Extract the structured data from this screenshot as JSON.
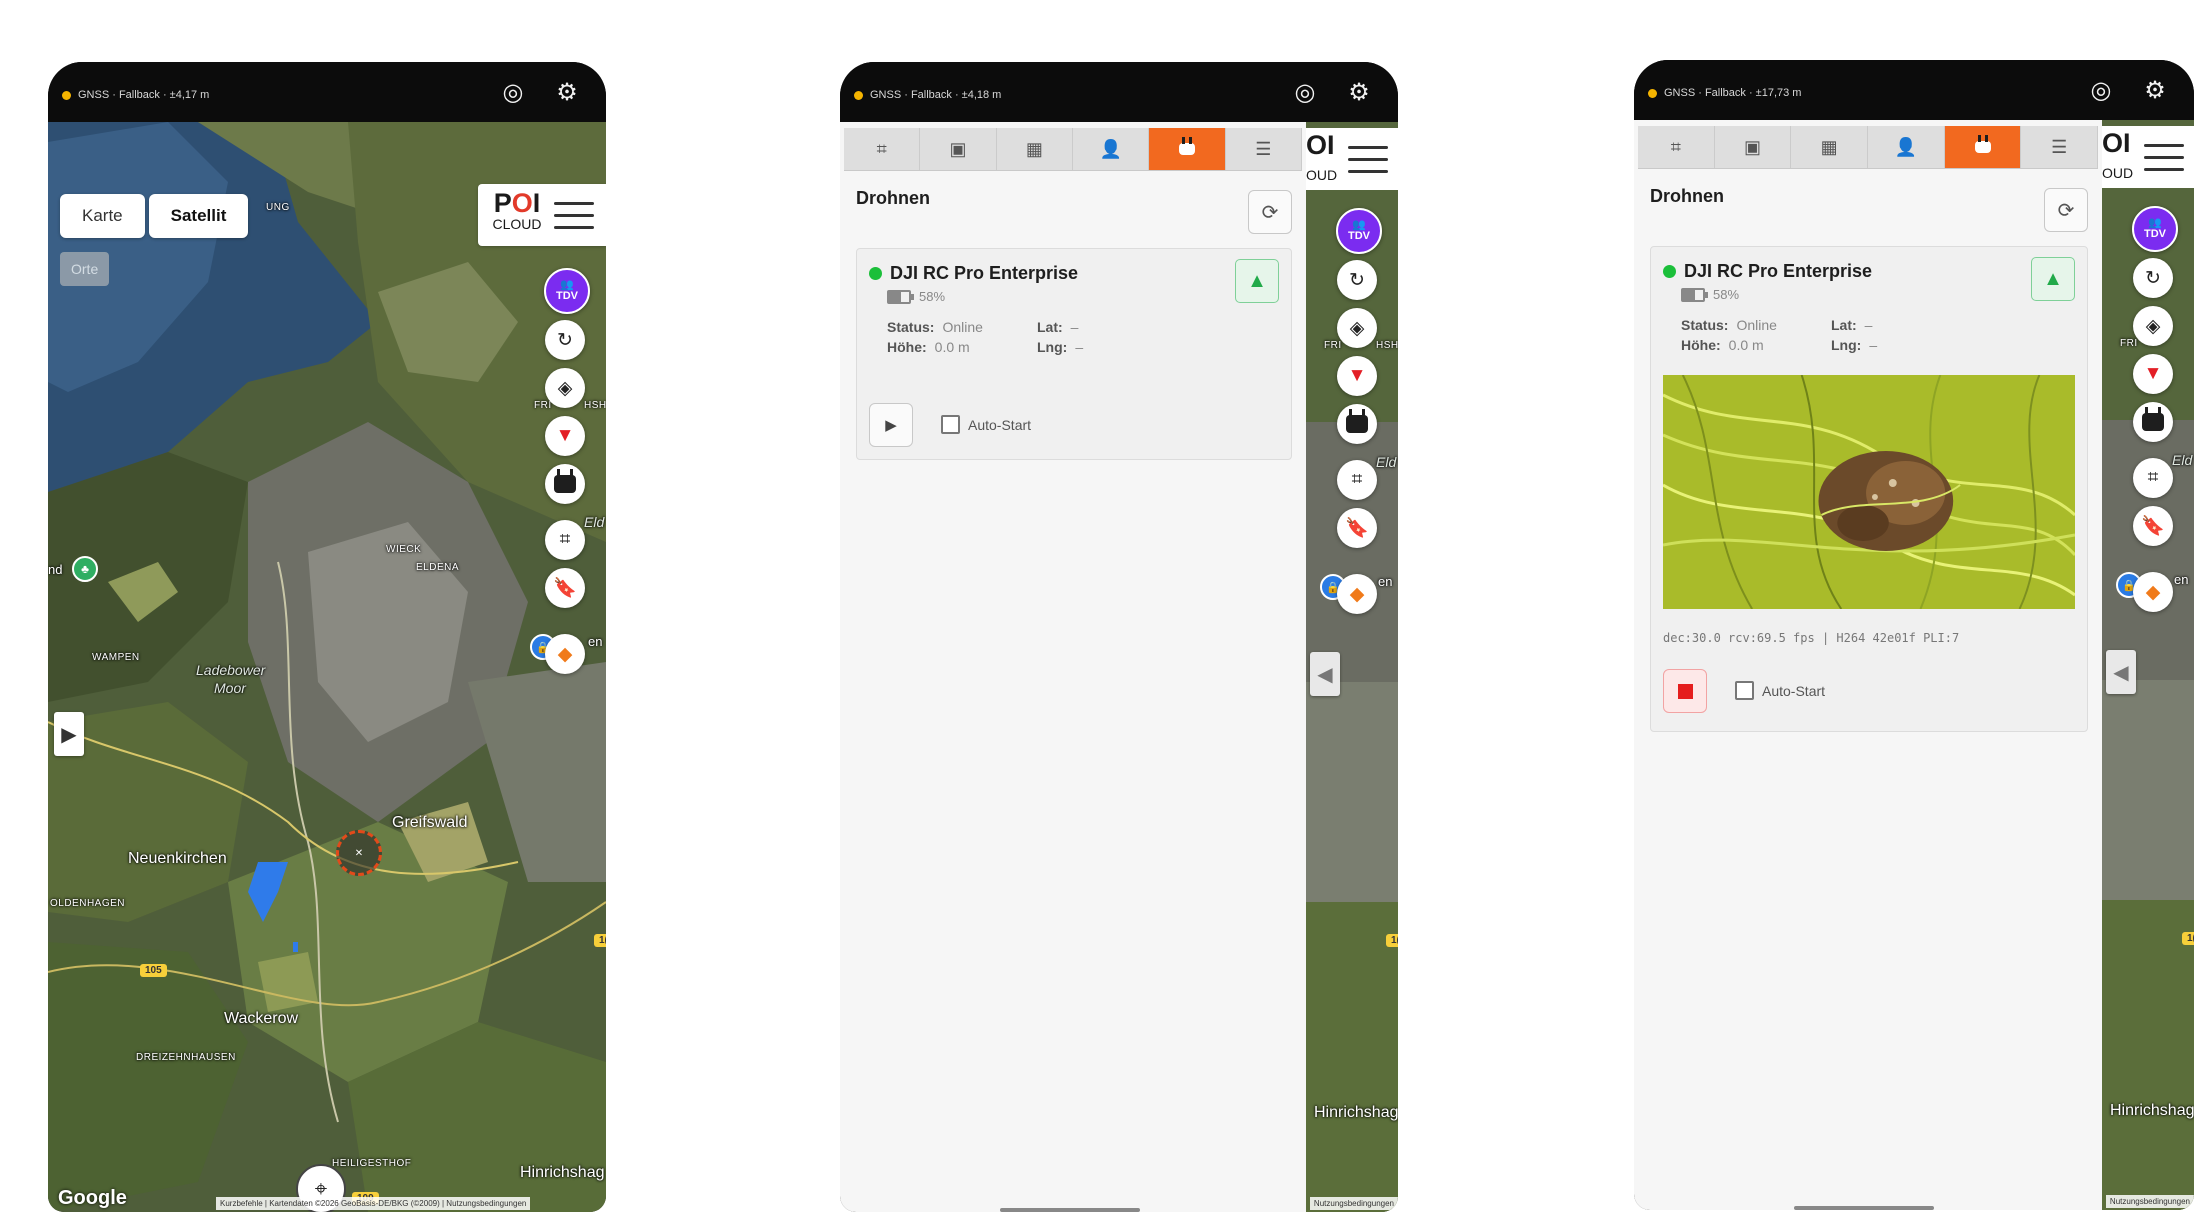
{
  "gnss": {
    "p1": "GNSS · Fallback · ±4,17 m",
    "p2": "GNSS · Fallback · ±4,18 m",
    "p3": "GNSS · Fallback · ±17,73 m"
  },
  "map": {
    "toggle": [
      "Karte",
      "Satellit"
    ],
    "active_toggle": "Satellit",
    "orte_label": "Orte",
    "logo_main_a": "P",
    "logo_main_b": "O",
    "logo_main_c": "I",
    "logo_sub": "CLOUD",
    "logo_partial_main": "OI",
    "logo_partial_sub": "OUD",
    "tdv_label": "TDV",
    "labels": {
      "ung": "UNG",
      "wieck": "WIECK",
      "eldena": "ELDENA",
      "wampen": "WAMPEN",
      "ladebower": "Ladebower",
      "moor": "Moor",
      "greifswald": "Greifswald",
      "neuenkirchen": "Neuenkirchen",
      "oldenhagen": "OLDENHAGEN",
      "wackerow": "Wackerow",
      "dreizehnhausen": "DREIZEHNHAUSEN",
      "heiligsthof": "HEILIGESTHOF",
      "hinrichshagen": "Hinrichshag",
      "fri": "FRI",
      "hsh": "HSH",
      "eld": "Eld",
      "nd": "nd",
      "en": "en",
      "road105": "105",
      "road109": "109",
      "road1a": "1(",
      "road1b": "1("
    },
    "google": "Google",
    "attribution": "Kurzbefehle | Kartendaten ©2026 GeoBasis-DE/BKG (©2009) | Nutzungsbedingungen",
    "attribution_short": "Nutzungsbedingungen"
  },
  "panel": {
    "title": "Drohnen",
    "tabs": [
      "draw-tool-icon",
      "layers-tab-icon",
      "calendar-icon",
      "people-icon",
      "drone-icon",
      "list-icon"
    ],
    "active_tab": "drone-icon",
    "drone": {
      "name": "DJI RC Pro Enterprise",
      "battery": "58%",
      "battery_level": 0.58,
      "status_label": "Status:",
      "status_value": "Online",
      "height_label": "Höhe:",
      "height_value": "0.0 m",
      "lat_label": "Lat:",
      "lat_value": "–",
      "lng_label": "Lng:",
      "lng_value": "–",
      "autostart_label": "Auto-Start"
    },
    "video_stats": "dec:30.0 rcv:69.5 fps | H264 42e01f PLI:7"
  },
  "colors": {
    "accent_tab": "#f2691f",
    "online": "#1bbf3a",
    "tdv": "#7b2cf0",
    "filter": "#e31f26",
    "stop": "#e51d1d"
  }
}
